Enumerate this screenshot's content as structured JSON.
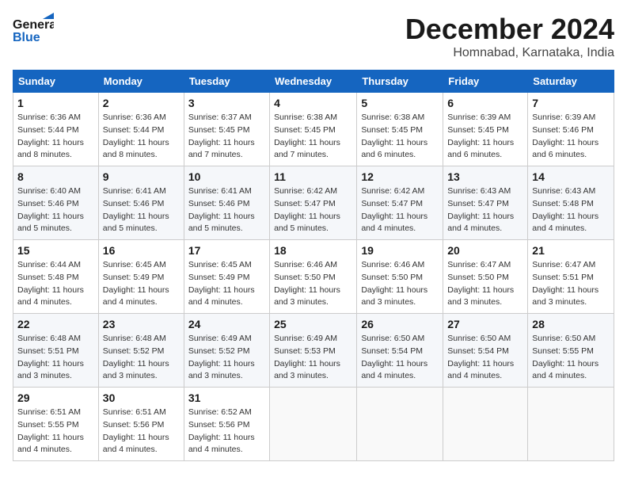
{
  "logo": {
    "line1": "General",
    "line2": "Blue"
  },
  "header": {
    "month": "December 2024",
    "location": "Homnabad, Karnataka, India"
  },
  "weekdays": [
    "Sunday",
    "Monday",
    "Tuesday",
    "Wednesday",
    "Thursday",
    "Friday",
    "Saturday"
  ],
  "weeks": [
    [
      {
        "day": "1",
        "sunrise": "6:36 AM",
        "sunset": "5:44 PM",
        "daylight": "11 hours and 8 minutes."
      },
      {
        "day": "2",
        "sunrise": "6:36 AM",
        "sunset": "5:44 PM",
        "daylight": "11 hours and 8 minutes."
      },
      {
        "day": "3",
        "sunrise": "6:37 AM",
        "sunset": "5:45 PM",
        "daylight": "11 hours and 7 minutes."
      },
      {
        "day": "4",
        "sunrise": "6:38 AM",
        "sunset": "5:45 PM",
        "daylight": "11 hours and 7 minutes."
      },
      {
        "day": "5",
        "sunrise": "6:38 AM",
        "sunset": "5:45 PM",
        "daylight": "11 hours and 6 minutes."
      },
      {
        "day": "6",
        "sunrise": "6:39 AM",
        "sunset": "5:45 PM",
        "daylight": "11 hours and 6 minutes."
      },
      {
        "day": "7",
        "sunrise": "6:39 AM",
        "sunset": "5:46 PM",
        "daylight": "11 hours and 6 minutes."
      }
    ],
    [
      {
        "day": "8",
        "sunrise": "6:40 AM",
        "sunset": "5:46 PM",
        "daylight": "11 hours and 5 minutes."
      },
      {
        "day": "9",
        "sunrise": "6:41 AM",
        "sunset": "5:46 PM",
        "daylight": "11 hours and 5 minutes."
      },
      {
        "day": "10",
        "sunrise": "6:41 AM",
        "sunset": "5:46 PM",
        "daylight": "11 hours and 5 minutes."
      },
      {
        "day": "11",
        "sunrise": "6:42 AM",
        "sunset": "5:47 PM",
        "daylight": "11 hours and 5 minutes."
      },
      {
        "day": "12",
        "sunrise": "6:42 AM",
        "sunset": "5:47 PM",
        "daylight": "11 hours and 4 minutes."
      },
      {
        "day": "13",
        "sunrise": "6:43 AM",
        "sunset": "5:47 PM",
        "daylight": "11 hours and 4 minutes."
      },
      {
        "day": "14",
        "sunrise": "6:43 AM",
        "sunset": "5:48 PM",
        "daylight": "11 hours and 4 minutes."
      }
    ],
    [
      {
        "day": "15",
        "sunrise": "6:44 AM",
        "sunset": "5:48 PM",
        "daylight": "11 hours and 4 minutes."
      },
      {
        "day": "16",
        "sunrise": "6:45 AM",
        "sunset": "5:49 PM",
        "daylight": "11 hours and 4 minutes."
      },
      {
        "day": "17",
        "sunrise": "6:45 AM",
        "sunset": "5:49 PM",
        "daylight": "11 hours and 4 minutes."
      },
      {
        "day": "18",
        "sunrise": "6:46 AM",
        "sunset": "5:50 PM",
        "daylight": "11 hours and 3 minutes."
      },
      {
        "day": "19",
        "sunrise": "6:46 AM",
        "sunset": "5:50 PM",
        "daylight": "11 hours and 3 minutes."
      },
      {
        "day": "20",
        "sunrise": "6:47 AM",
        "sunset": "5:50 PM",
        "daylight": "11 hours and 3 minutes."
      },
      {
        "day": "21",
        "sunrise": "6:47 AM",
        "sunset": "5:51 PM",
        "daylight": "11 hours and 3 minutes."
      }
    ],
    [
      {
        "day": "22",
        "sunrise": "6:48 AM",
        "sunset": "5:51 PM",
        "daylight": "11 hours and 3 minutes."
      },
      {
        "day": "23",
        "sunrise": "6:48 AM",
        "sunset": "5:52 PM",
        "daylight": "11 hours and 3 minutes."
      },
      {
        "day": "24",
        "sunrise": "6:49 AM",
        "sunset": "5:52 PM",
        "daylight": "11 hours and 3 minutes."
      },
      {
        "day": "25",
        "sunrise": "6:49 AM",
        "sunset": "5:53 PM",
        "daylight": "11 hours and 3 minutes."
      },
      {
        "day": "26",
        "sunrise": "6:50 AM",
        "sunset": "5:54 PM",
        "daylight": "11 hours and 4 minutes."
      },
      {
        "day": "27",
        "sunrise": "6:50 AM",
        "sunset": "5:54 PM",
        "daylight": "11 hours and 4 minutes."
      },
      {
        "day": "28",
        "sunrise": "6:50 AM",
        "sunset": "5:55 PM",
        "daylight": "11 hours and 4 minutes."
      }
    ],
    [
      {
        "day": "29",
        "sunrise": "6:51 AM",
        "sunset": "5:55 PM",
        "daylight": "11 hours and 4 minutes."
      },
      {
        "day": "30",
        "sunrise": "6:51 AM",
        "sunset": "5:56 PM",
        "daylight": "11 hours and 4 minutes."
      },
      {
        "day": "31",
        "sunrise": "6:52 AM",
        "sunset": "5:56 PM",
        "daylight": "11 hours and 4 minutes."
      },
      null,
      null,
      null,
      null
    ]
  ],
  "labels": {
    "sunrise": "Sunrise: ",
    "sunset": "Sunset: ",
    "daylight": "Daylight: "
  }
}
